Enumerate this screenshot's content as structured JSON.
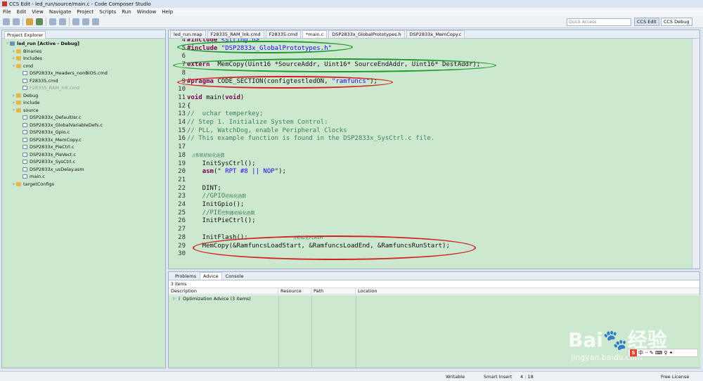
{
  "window": {
    "title": "CCS Edit - led_run/source/main.c - Code Composer Studio"
  },
  "menu": [
    "File",
    "Edit",
    "View",
    "Navigate",
    "Project",
    "Scripts",
    "Run",
    "Window",
    "Help"
  ],
  "quick_access": {
    "placeholder": "Quick Access"
  },
  "perspectives": [
    "CCS Edit",
    "CCS Debug"
  ],
  "project_explorer": {
    "title": "Project Explorer",
    "items": [
      {
        "label": "led_run  [Active - Debug]",
        "type": "project",
        "depth": 0,
        "exp": true,
        "bold": true
      },
      {
        "label": "Binaries",
        "type": "fold",
        "depth": 1
      },
      {
        "label": "Includes",
        "type": "fold",
        "depth": 1
      },
      {
        "label": "cmd",
        "type": "fold",
        "depth": 1,
        "exp": true
      },
      {
        "label": "DSP2833x_Headers_nonBIOS.cmd",
        "type": "file",
        "depth": 2
      },
      {
        "label": "F28335.cmd",
        "type": "file",
        "depth": 2
      },
      {
        "label": "F28335_RAM_lnk.cmd",
        "type": "file",
        "depth": 2,
        "gray": true
      },
      {
        "label": "Debug",
        "type": "fold",
        "depth": 1
      },
      {
        "label": "include",
        "type": "fold",
        "depth": 1
      },
      {
        "label": "source",
        "type": "fold",
        "depth": 1,
        "exp": true
      },
      {
        "label": "DSP2833x_DefaultIsr.c",
        "type": "file",
        "depth": 2
      },
      {
        "label": "DSP2833x_GlobalVariableDefs.c",
        "type": "file",
        "depth": 2
      },
      {
        "label": "DSP2833x_Gpio.c",
        "type": "file",
        "depth": 2
      },
      {
        "label": "DSP2833x_MemCopy.c",
        "type": "file",
        "depth": 2
      },
      {
        "label": "DSP2833x_PieCtrl.c",
        "type": "file",
        "depth": 2
      },
      {
        "label": "DSP2833x_PieVect.c",
        "type": "file",
        "depth": 2
      },
      {
        "label": "DSP2833x_SysCtrl.c",
        "type": "file",
        "depth": 2
      },
      {
        "label": "DSP2833x_usDelay.asm",
        "type": "file",
        "depth": 2
      },
      {
        "label": "main.c",
        "type": "file",
        "depth": 2
      },
      {
        "label": "targetConfigs",
        "type": "fold",
        "depth": 1
      }
    ]
  },
  "editor_tabs": [
    "led_run.map",
    "F28335_RAM_lnk.cmd",
    "F28335.cmd",
    "*main.c",
    "DSP2833x_GlobalPrototypes.h",
    "DSP2833x_MemCopy.c"
  ],
  "active_tab": 3,
  "code_lines": [
    {
      "n": "4",
      "parts": [
        [
          "dir",
          "#include "
        ],
        [
          "str",
          "<string.h>"
        ]
      ]
    },
    {
      "n": "5",
      "parts": [
        [
          "dir",
          "#include "
        ],
        [
          "str",
          "\"DSP2833x_GlobalPrototypes.h\""
        ]
      ]
    },
    {
      "n": "6",
      "parts": []
    },
    {
      "n": "7",
      "parts": [
        [
          "kw",
          "extern"
        ],
        [
          "",
          "  MemCopy(Uint16 *SourceAddr, Uint16* SourceEndAddr, Uint16* DestAddr);"
        ]
      ]
    },
    {
      "n": "8",
      "parts": []
    },
    {
      "n": "9",
      "parts": [
        [
          "dir",
          "#pragma"
        ],
        [
          "",
          " CODE_SECTION(configtestledON, "
        ],
        [
          "str",
          "\"ramfuncs\""
        ],
        [
          "",
          ");"
        ]
      ]
    },
    {
      "n": "10",
      "parts": []
    },
    {
      "n": "11",
      "parts": [
        [
          "kw",
          "void"
        ],
        [
          "",
          " main("
        ],
        [
          "kw",
          "void"
        ],
        [
          "",
          ")"
        ]
      ]
    },
    {
      "n": "12",
      "parts": [
        [
          "",
          "{"
        ]
      ]
    },
    {
      "n": "13",
      "parts": [
        [
          "cm",
          "//  uchar temperkey;"
        ]
      ]
    },
    {
      "n": "14",
      "parts": [
        [
          "cm",
          "// Step 1. Initialize System Control:"
        ]
      ]
    },
    {
      "n": "15",
      "parts": [
        [
          "cm",
          "// PLL, WatchDog, enable Peripheral Clocks"
        ]
      ]
    },
    {
      "n": "16",
      "parts": [
        [
          "cm",
          "// This example function is found in the DSP2833x_SysCtrl.c file."
        ]
      ]
    },
    {
      "n": "17",
      "parts": []
    },
    {
      "n": "18",
      "parts": [
        [
          "cmzh",
          "    //系统初始化函数"
        ]
      ]
    },
    {
      "n": "19",
      "parts": [
        [
          "",
          "    InitSysCtrl();"
        ]
      ]
    },
    {
      "n": "20",
      "parts": [
        [
          "",
          "    "
        ],
        [
          "kw",
          "asm"
        ],
        [
          "",
          "(\" "
        ],
        [
          "str",
          "RPT #8 || NOP"
        ],
        [
          "",
          "\");"
        ]
      ]
    },
    {
      "n": "21",
      "parts": []
    },
    {
      "n": "22",
      "parts": [
        [
          "",
          "    DINT;"
        ]
      ]
    },
    {
      "n": "23",
      "parts": [
        [
          "cm",
          "    //GPIO"
        ],
        [
          "cmzh",
          "初始化函数"
        ]
      ]
    },
    {
      "n": "24",
      "parts": [
        [
          "",
          "    InitGpio();"
        ]
      ]
    },
    {
      "n": "25",
      "parts": [
        [
          "cm",
          "    //PIE"
        ],
        [
          "cmzh",
          "控制器初始化函数"
        ]
      ]
    },
    {
      "n": "26",
      "parts": [
        [
          "",
          "    InitPieCtrl();"
        ]
      ]
    },
    {
      "n": "27",
      "parts": []
    },
    {
      "n": "28",
      "parts": [
        [
          "",
          "    InitFlash();            "
        ],
        [
          "cmzh",
          "//初始化FLASH"
        ]
      ]
    },
    {
      "n": "29",
      "parts": [
        [
          "",
          "    MemCopy(&RamfuncsLoadStart, &RamfuncsLoadEnd, &RamfuncsRunStart);"
        ]
      ]
    },
    {
      "n": "30",
      "parts": []
    }
  ],
  "bottom": {
    "tabs": [
      "Problems",
      "Advice",
      "Console"
    ],
    "active": 1,
    "count": "3 items",
    "columns": [
      "Description",
      "Resource",
      "Path",
      "Location"
    ],
    "rows": [
      "Optimization Advice (3 items)"
    ]
  },
  "status": {
    "writable": "Writable",
    "insert": "Smart Insert",
    "pos": "4 : 18",
    "license": "Free License"
  },
  "watermark": {
    "brand": "Bai",
    "brand2": "经验",
    "url": "jingyan.baidu.com"
  },
  "ime_label": "S"
}
